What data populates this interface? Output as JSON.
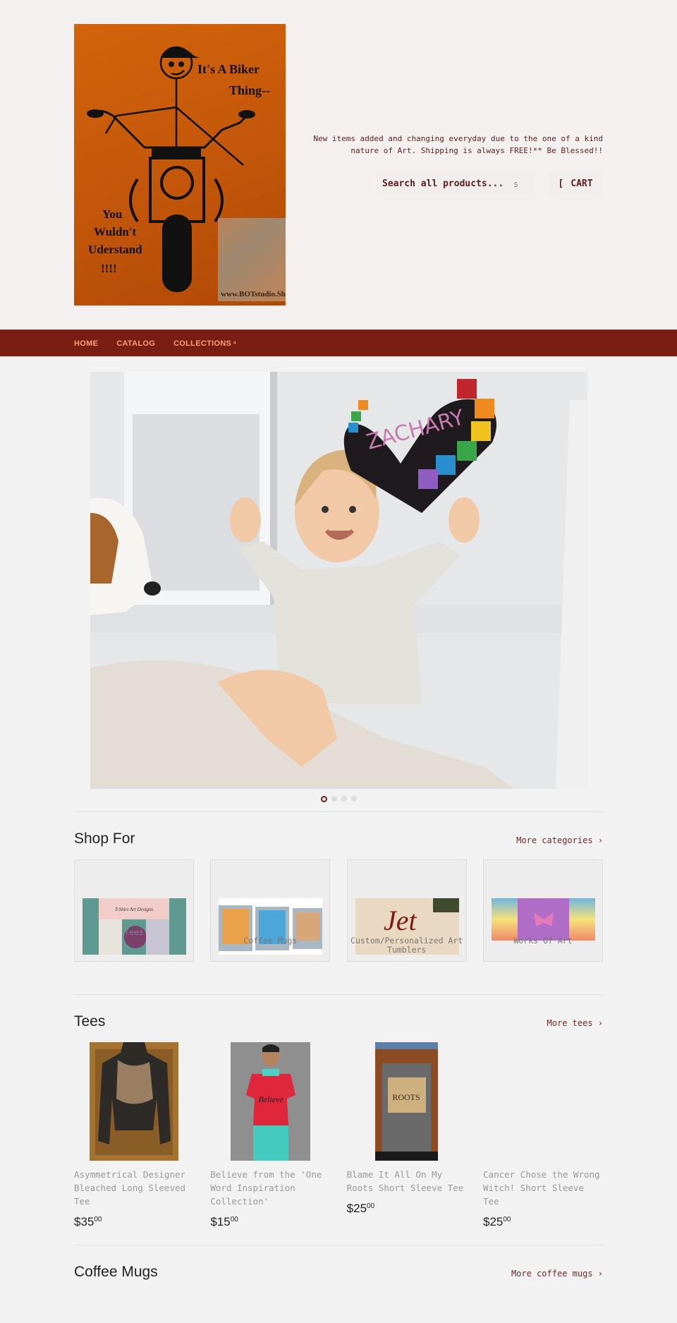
{
  "header": {
    "logo_alt": "It's A Biker Thing -- You Wouldn't Understand !!!!",
    "logo_watermark": "www.BOTstudio.Sh",
    "tagline": "New items added and changing everyday due to the one of a kind nature of Art. Shipping is always FREE!** Be Blessed!!",
    "search": {
      "placeholder": "Search all products...",
      "icon_glyph": "s"
    },
    "cart": {
      "icon_glyph": "[",
      "label": "CART"
    }
  },
  "nav": {
    "items": [
      {
        "label": "HOME"
      },
      {
        "label": "CATALOG"
      },
      {
        "label": "COLLECTIONS",
        "caret": "⁴"
      }
    ]
  },
  "hero": {
    "alt": "Baby with dog and personalized ZACHARY puzzle heart",
    "heart_text": "ZACHARY",
    "slides": 4,
    "active_slide": 1
  },
  "shop_for": {
    "title": "Shop For",
    "more": "More categories ›",
    "categories": [
      {
        "label": "Tees",
        "image_caption": "T-Shirt Art Designs"
      },
      {
        "label": "Coffee Mugs"
      },
      {
        "label": "Custom/Personalized Art Tumblers"
      },
      {
        "label": "Works Of Art"
      }
    ]
  },
  "tees": {
    "title": "Tees",
    "more": "More tees ›",
    "products": [
      {
        "title": "Asymmetrical Designer Bleached Long Sleeved Tee",
        "price_dollars": "$35",
        "price_cents": "00"
      },
      {
        "title": "Believe from the 'One Word Inspiration Collection'",
        "price_dollars": "$15",
        "price_cents": "00"
      },
      {
        "title": "Blame It All On My Roots Short Sleeve Tee",
        "price_dollars": "$25",
        "price_cents": "00"
      },
      {
        "title": "Cancer Chose the Wrong Witch! Short Sleeve Tee",
        "price_dollars": "$25",
        "price_cents": "00"
      }
    ]
  },
  "coffee_mugs": {
    "title": "Coffee Mugs",
    "more": "More coffee mugs ›"
  },
  "colors": {
    "nav_bg": "#7a1d12",
    "nav_text": "#f5a17c",
    "accent_text": "#5a1f1f",
    "page_bg": "#f3f2f2"
  }
}
